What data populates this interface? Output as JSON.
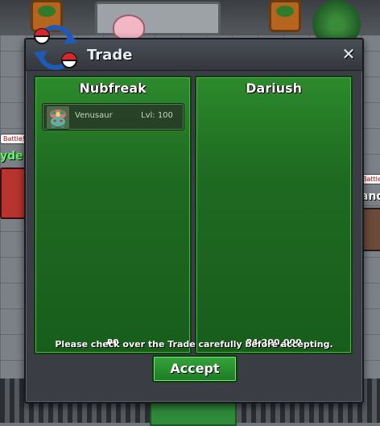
{
  "dialog": {
    "title": "Trade",
    "close_glyph": "✕"
  },
  "left_panel": {
    "player_name": "Nubfreak",
    "pokemon": [
      {
        "name": "Venusaur",
        "level": "Lvl: 100",
        "icon": "venusaur-icon"
      }
    ],
    "money": "₽0"
  },
  "right_panel": {
    "player_name": "Dariush",
    "pokemon": [],
    "money": "₽4,200,000"
  },
  "notice": "Please check over the Trade carefully before accepting.",
  "accept_label": "Accept",
  "background": {
    "left_tag": "Battle!",
    "left_name": "yder",
    "right_tag": "Battle!",
    "right_name": "and"
  },
  "colors": {
    "panel_green": "#1f6a22",
    "accept_green": "#2f9a34",
    "dialog_bg": "#3a3d44"
  }
}
